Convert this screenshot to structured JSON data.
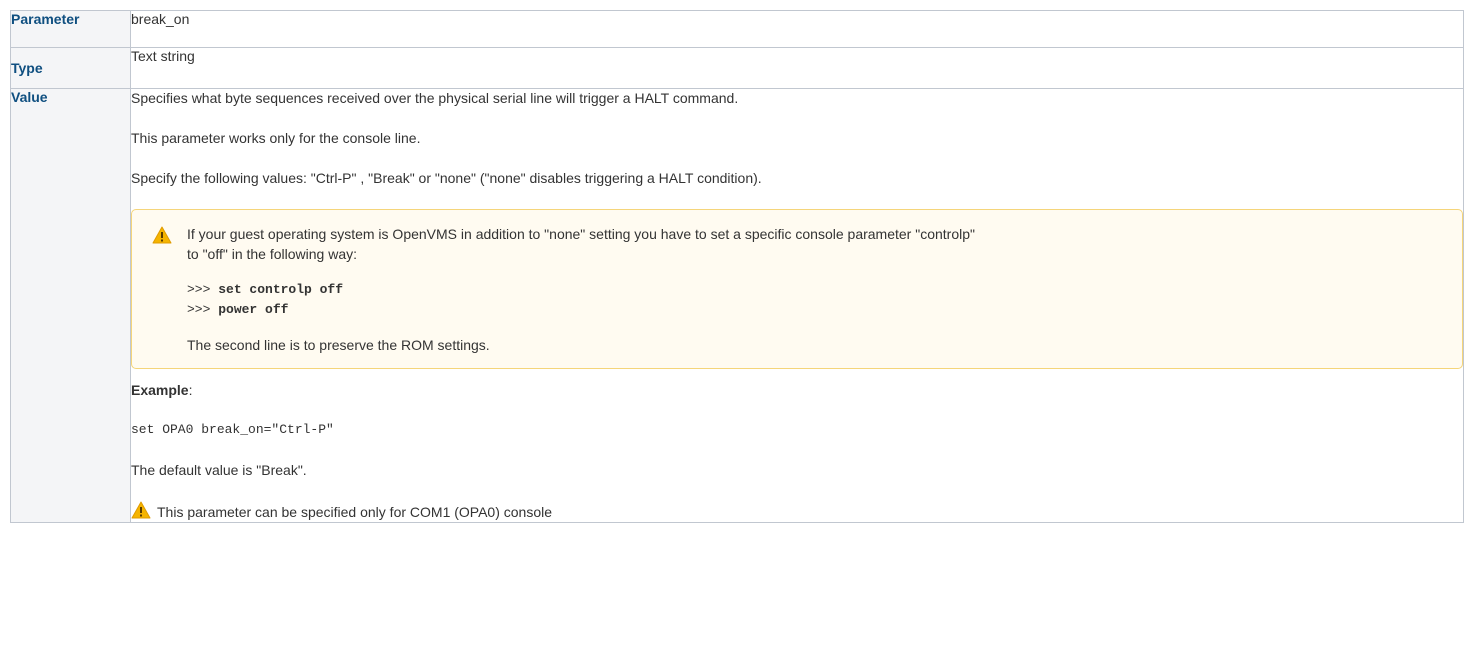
{
  "rows": [
    {
      "header": "Parameter",
      "value": "break_on"
    },
    {
      "header": "Type",
      "value": "Text string"
    },
    {
      "header": "Value"
    }
  ],
  "value_cell": {
    "para1": "Specifies what byte sequences received over the physical serial line will trigger a HALT command.",
    "para2": "This parameter works only for the console line.",
    "para3": "Specify the following values: \"Ctrl-P\" , \"Break\" or \"none\" (\"none\" disables triggering a HALT condition).",
    "warning": {
      "icon": "warning-icon",
      "text_line1": "If your guest operating system is OpenVMS in addition to \"none\" setting you have to set a specific console parameter \"controlp\"",
      "text_line2": "to \"off\" in the following way:",
      "code": [
        {
          "prompt": ">>>",
          "command": "set controlp off"
        },
        {
          "prompt": ">>>",
          "command": "power off"
        }
      ],
      "footer": "The second line is to preserve the ROM settings."
    },
    "example_label": "Example",
    "example_colon": ":",
    "example_code": "set OPA0 break_on=\"Ctrl-P\"",
    "default_text": "The default value is \"Break\".",
    "note": {
      "icon": "warning-icon",
      "text": "This parameter can be specified only for COM1 (OPA0) console"
    }
  },
  "colors": {
    "header_text": "#0f4f80",
    "header_bg": "#f4f5f7",
    "border": "#c1c7d0",
    "panel_border": "#f5d57a",
    "panel_bg": "#fffbf1",
    "warning_icon": "#f5b400"
  }
}
